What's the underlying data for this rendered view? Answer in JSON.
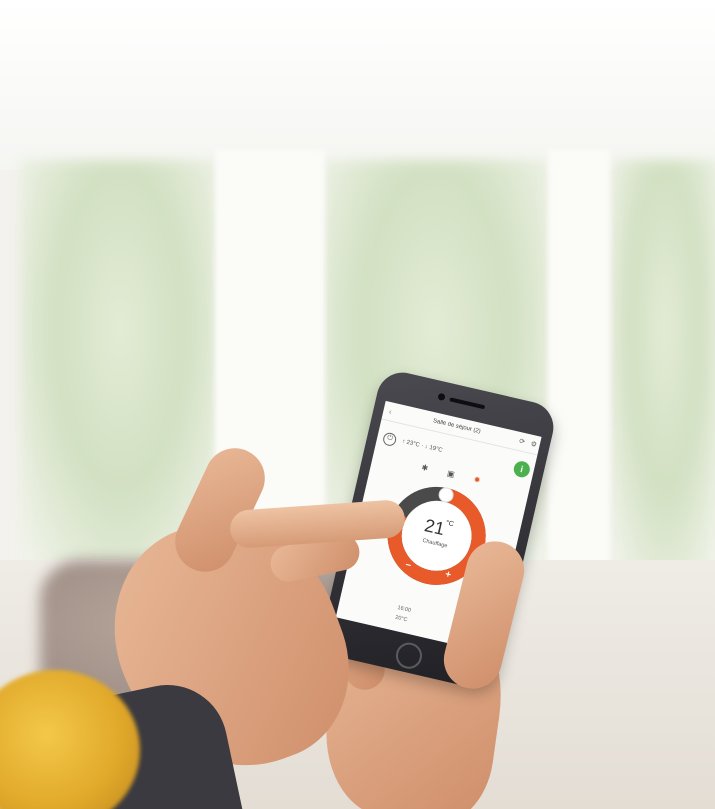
{
  "app": {
    "title": "Salle de séjour (2)",
    "temperature_range": "↑ 23°C · ↓ 19°C",
    "current_temperature": "21",
    "temperature_unit": "°C",
    "mode_label": "Chauffage",
    "footer_line1": "16:00",
    "footer_line2": "20°C",
    "dial_level": 0.8
  },
  "icons": {
    "back": "back-arrow-icon",
    "sync": "sync-icon",
    "settings": "gear-icon",
    "power": "power-icon",
    "info": "info-icon",
    "cooling": "snowflake-icon",
    "auto": "auto-mode-icon",
    "heating": "sun-icon",
    "minus": "minus-icon",
    "plus": "plus-icon"
  },
  "colors": {
    "accent": "#e85a2a",
    "dial_track": "#4a4a4a",
    "info_green": "#4bb04e"
  }
}
